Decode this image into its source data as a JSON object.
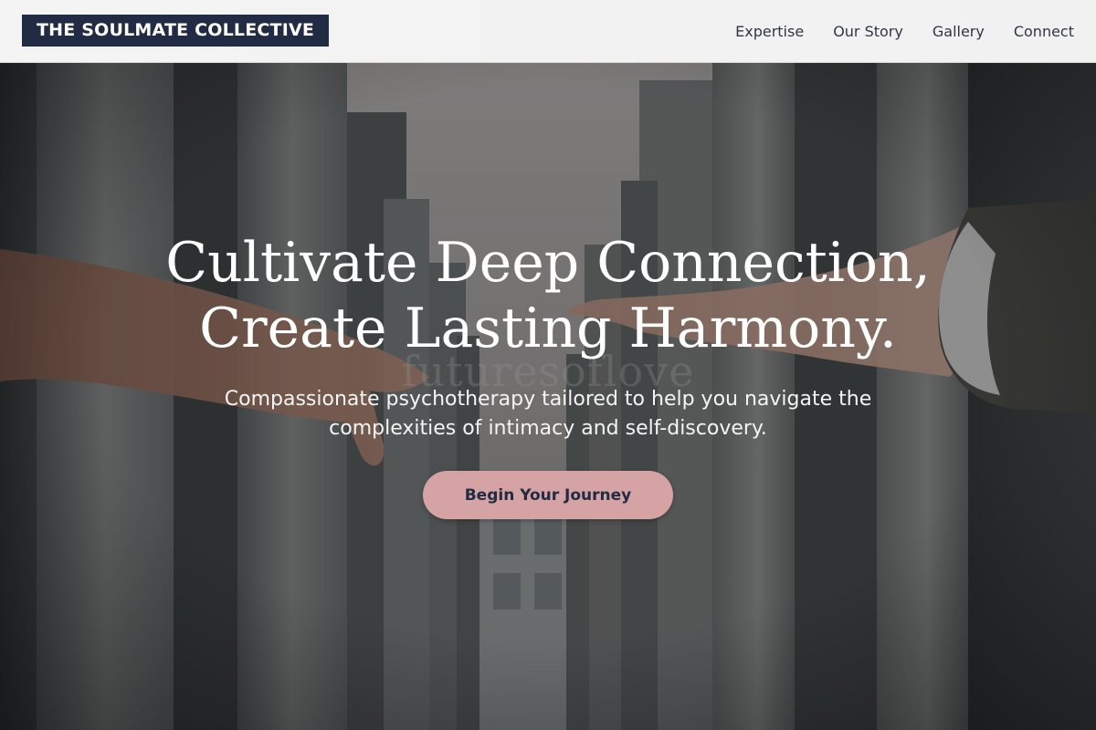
{
  "header": {
    "brand": "THE SOULMATE COLLECTIVE",
    "nav": [
      {
        "label": "Expertise"
      },
      {
        "label": "Our Story"
      },
      {
        "label": "Gallery"
      },
      {
        "label": "Connect"
      }
    ]
  },
  "hero": {
    "title_line1": "Cultivate Deep Connection,",
    "title_line2": "Create Lasting Harmony.",
    "watermark": "futuresoflove",
    "subtitle": "Compassionate psychotherapy tailored to help you navigate the complexities of intimacy and self-discovery.",
    "cta_label": "Begin Your Journey",
    "background_image": "two-hands-reaching-between-concrete-pillars"
  },
  "colors": {
    "brand_navy": "#222b44",
    "cta_pink": "#d5a3a3",
    "header_bg": "#f2f2f2",
    "nav_text": "#2f3747"
  }
}
